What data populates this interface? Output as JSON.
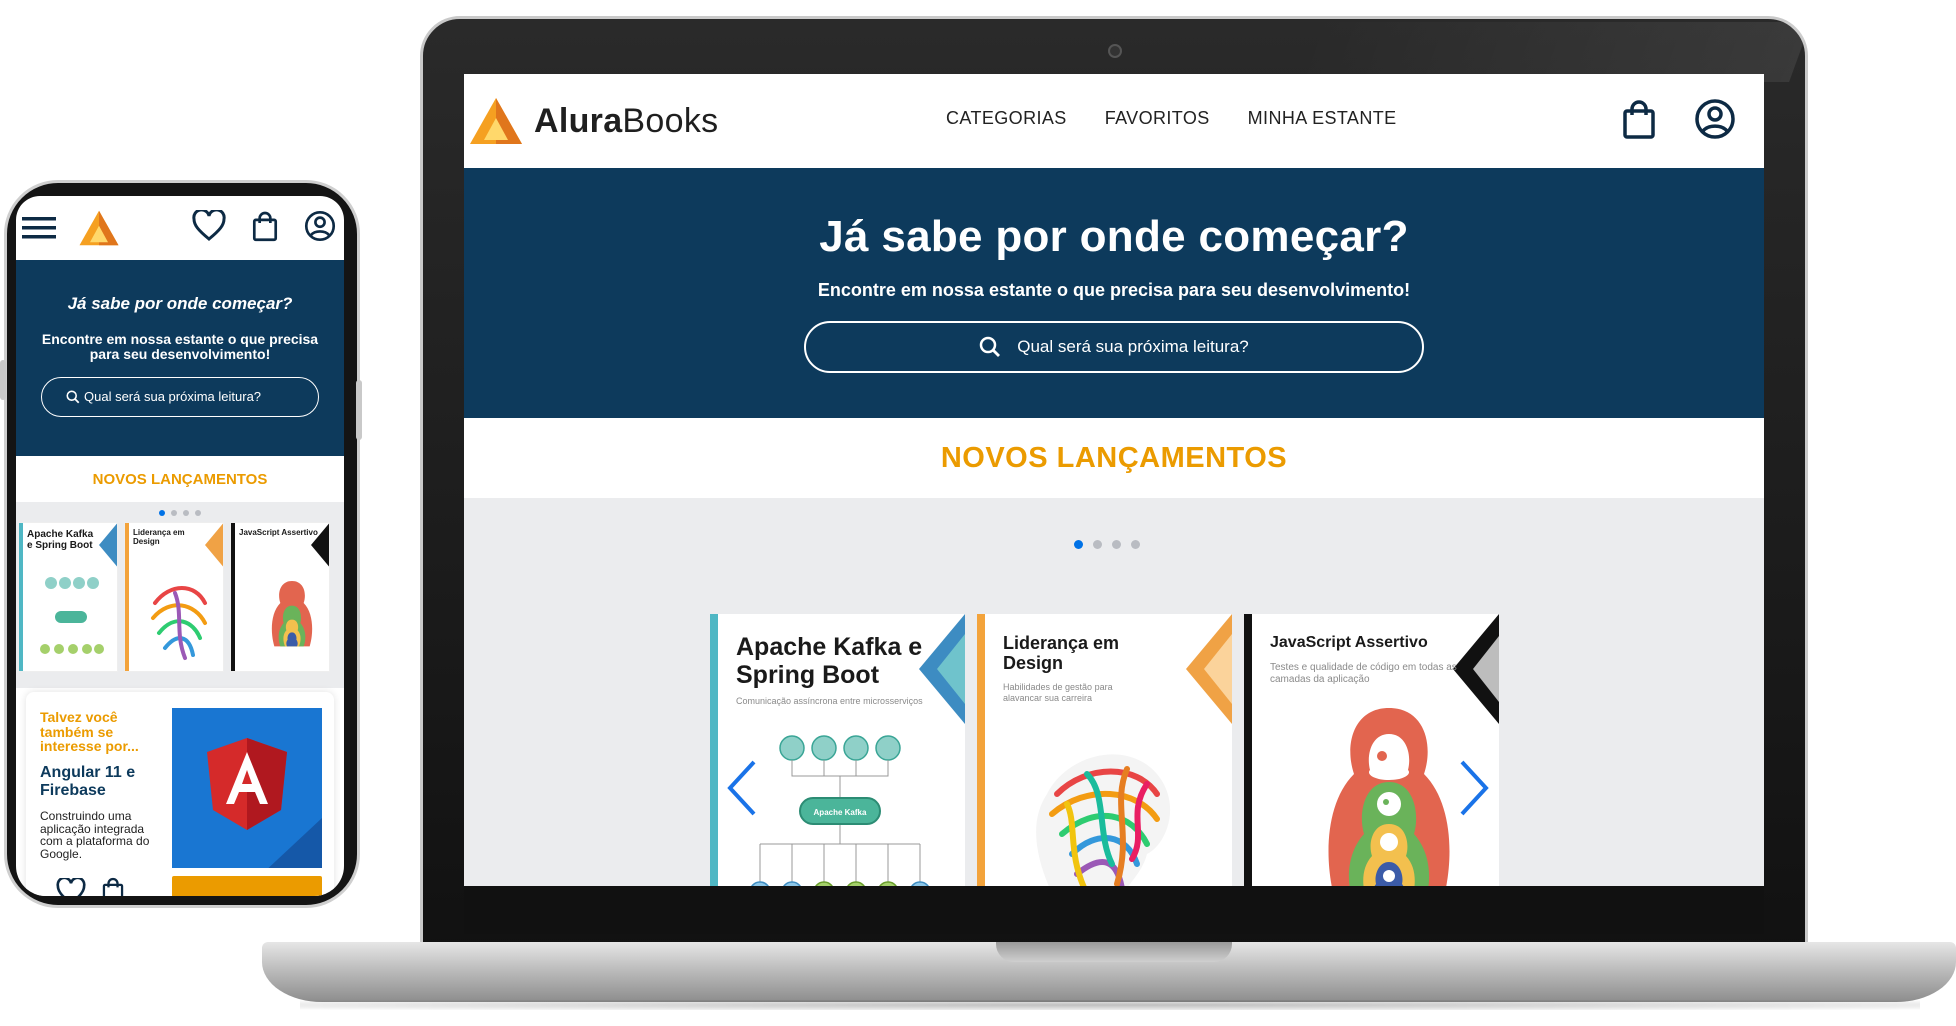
{
  "brand": {
    "name_bold": "Alura",
    "name_light": "Books",
    "accent": "#eb9b00",
    "primary": "#0d3a5c",
    "link_blue": "#1a73e8"
  },
  "desktop": {
    "nav": [
      "CATEGORIAS",
      "FAVORITOS",
      "MINHA ESTANTE"
    ],
    "hero": {
      "title": "Já sabe por onde começar?",
      "subtitle": "Encontre em nossa estante o que precisa para seu desenvolvimento!",
      "search_placeholder": "Qual será sua próxima leitura?"
    },
    "section_title": "NOVOS LANÇAMENTOS",
    "carousel": {
      "dots": 4,
      "active_dot": 0,
      "books": [
        {
          "title": "Apache Kafka e Spring Boot",
          "subtitle": "Comunicação assíncrona entre microsserviços",
          "accent": "#4fb7c4",
          "diagram_label": "Apache Kafka"
        },
        {
          "title": "Liderança em Design",
          "subtitle": "Habilidades de gestão para alavancar sua carreira",
          "accent": "#f3a33b"
        },
        {
          "title": "JavaScript Assertivo",
          "subtitle": "Testes e qualidade de código em todas as camadas da aplicação",
          "accent": "#111111"
        }
      ]
    }
  },
  "mobile": {
    "hero": {
      "title": "Já sabe por onde começar?",
      "subtitle": "Encontre em nossa estante o que precisa para seu desenvolvimento!",
      "search_placeholder": "Qual será sua próxima leitura?"
    },
    "section_title": "NOVOS LANÇAMENTOS",
    "books": [
      {
        "title": "Apache Kafka e Spring Boot"
      },
      {
        "title": "Liderança em Design"
      },
      {
        "title": "JavaScript Assertivo"
      }
    ],
    "suggestion": {
      "kicker": "Talvez você também se interesse por...",
      "title": "Angular 11 e Firebase",
      "description": "Construindo uma aplicação integrada com a plataforma do Google."
    }
  },
  "icons": [
    "logo-icon",
    "bag-icon",
    "user-icon",
    "search-icon",
    "menu-icon",
    "heart-icon",
    "chevron-left-icon",
    "chevron-right-icon",
    "angular-icon"
  ]
}
